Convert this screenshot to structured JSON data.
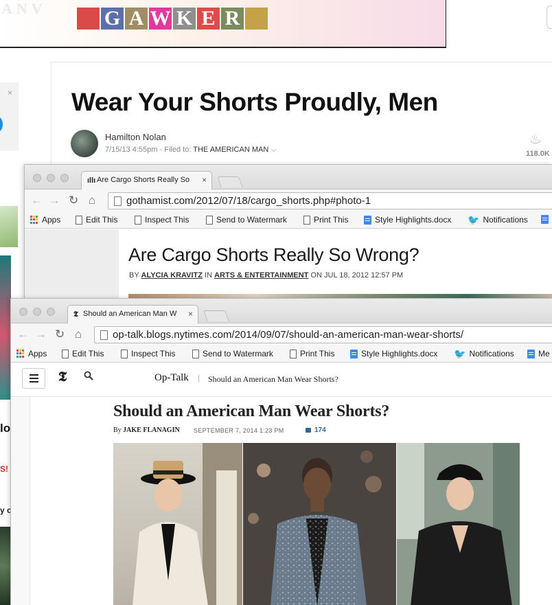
{
  "gawker": {
    "bg_letters": "ANV",
    "logo_letters": [
      "",
      "G",
      "A",
      "W",
      "K",
      "E",
      "R",
      ""
    ],
    "logo_colors": [
      "#d94a48",
      "#5c6fa8",
      "#a08d63",
      "#e23a9c",
      "#8f8f8f",
      "#df4a4a",
      "#7b8c5c",
      "#c4a248"
    ],
    "title": "Wear Your Shorts Proudly, Men",
    "author": "Hamilton Nolan",
    "timestamp": "7/15/13 4:55pm",
    "filed_label": "Filed to:",
    "category": "THE AMERICAN MAN",
    "count": "118.0K",
    "side_close": "×",
    "side_lo": "lo",
    "side_red": "S!",
    "side_yo": "y o"
  },
  "gothamist": {
    "tab_title": "Are Cargo Shorts Really So",
    "tab_close": "×",
    "url": "gothamist.com/2012/07/18/cargo_shorts.php#photo-1",
    "title": "Are Cargo Shorts Really So Wrong?",
    "by": "BY",
    "author": "ALYCIA KRAVITZ",
    "in": "IN",
    "section": "ARTS & ENTERTAINMENT",
    "on": "ON JUL 18, 2012 12:57 PM"
  },
  "bookmarks": {
    "apps": "Apps",
    "edit_this": "Edit This",
    "inspect_this": "Inspect This",
    "send_to_watermark": "Send to Watermark",
    "print_this": "Print This",
    "style_highlights": "Style Highlights.docx",
    "notifications": "Notifications",
    "me": "Me"
  },
  "nyt": {
    "tab_title": "Should an American Man W",
    "tab_close": "×",
    "url": "op-talk.blogs.nytimes.com/2014/09/07/should-an-american-man-wear-shorts/",
    "logo_t": "𝕿",
    "section": "Op-Talk",
    "breadcrumb": "Should an American Man Wear Shorts?",
    "title": "Should an American Man Wear Shorts?",
    "by": "By",
    "author": "JAKE FLANAGIN",
    "date": "SEPTEMBER 7, 2014 1:23 PM",
    "comments": "174"
  }
}
